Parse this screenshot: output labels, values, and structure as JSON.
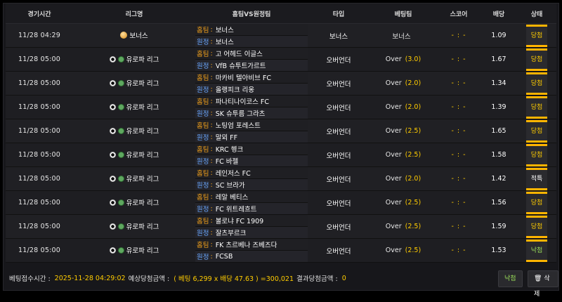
{
  "headers": {
    "time": "경기시간",
    "league": "리그명",
    "teams": "홈팀VS원정팀",
    "type": "타입",
    "betting_team": "베팅팀",
    "score": "스코어",
    "odds": "배당",
    "status": "상태"
  },
  "labels": {
    "home": "홈팀",
    "away": "원정",
    "over": "Over"
  },
  "rows": [
    {
      "time": "11/28 04:29",
      "league": "보너스",
      "league_icon": "coin-icon",
      "home": "보너스",
      "away": "보너스",
      "type": "보너스",
      "bet": "보너스",
      "line": "",
      "score": "- : -",
      "odds": "1.09",
      "status": "당첨"
    },
    {
      "time": "11/28 05:00",
      "league": "유로파 리그",
      "league_icon": "soccer-ball-icon",
      "home": "고 어헤드 이글스",
      "away": "VfB 슈투트가르트",
      "type": "오버언더",
      "bet": "Over",
      "line": "(3.0)",
      "score": "- : -",
      "odds": "1.67",
      "status": "당첨"
    },
    {
      "time": "11/28 05:00",
      "league": "유로파 리그",
      "league_icon": "soccer-ball-icon",
      "home": "마카비 텔아비브 FC",
      "away": "올랭피크 리옹",
      "type": "오버언더",
      "bet": "Over",
      "line": "(2.0)",
      "score": "- : -",
      "odds": "1.34",
      "status": "당첨"
    },
    {
      "time": "11/28 05:00",
      "league": "유로파 리그",
      "league_icon": "soccer-ball-icon",
      "home": "파나티나이코스 FC",
      "away": "SK 슈투름 그라츠",
      "type": "오버언더",
      "bet": "Over",
      "line": "(2.0)",
      "score": "- : -",
      "odds": "1.39",
      "status": "당첨"
    },
    {
      "time": "11/28 05:00",
      "league": "유로파 리그",
      "league_icon": "soccer-ball-icon",
      "home": "노팅엄 포레스트",
      "away": "말뫼 FF",
      "type": "오버언더",
      "bet": "Over",
      "line": "(2.5)",
      "score": "- : -",
      "odds": "1.65",
      "status": "당첨"
    },
    {
      "time": "11/28 05:00",
      "league": "유로파 리그",
      "league_icon": "soccer-ball-icon",
      "home": "KRC 헹크",
      "away": "FC 바젤",
      "type": "오버언더",
      "bet": "Over",
      "line": "(2.5)",
      "score": "- : -",
      "odds": "1.58",
      "status": "당첨"
    },
    {
      "time": "11/28 05:00",
      "league": "유로파 리그",
      "league_icon": "soccer-ball-icon",
      "home": "레인저스 FC",
      "away": "SC 브라가",
      "type": "오버언더",
      "bet": "Over",
      "line": "(2.0)",
      "score": "- : -",
      "odds": "1.42",
      "status": "적특"
    },
    {
      "time": "11/28 05:00",
      "league": "유로파 리그",
      "league_icon": "soccer-ball-icon",
      "home": "레알 베티스",
      "away": "FC 위트레흐트",
      "type": "오버언더",
      "bet": "Over",
      "line": "(2.5)",
      "score": "- : -",
      "odds": "1.56",
      "status": "당첨"
    },
    {
      "time": "11/28 05:00",
      "league": "유로파 리그",
      "league_icon": "soccer-ball-icon",
      "home": "볼로냐 FC 1909",
      "away": "잘츠부르크",
      "type": "오버언더",
      "bet": "Over",
      "line": "(2.5)",
      "score": "- : -",
      "odds": "1.59",
      "status": "당첨"
    },
    {
      "time": "11/28 05:00",
      "league": "유로파 리그",
      "league_icon": "soccer-ball-icon",
      "home": "FK 츠르베나 즈베즈다",
      "away": "FCSB",
      "type": "오버언더",
      "bet": "Over",
      "line": "(2.5)",
      "score": "- : -",
      "odds": "1.53",
      "status": "낙첨"
    }
  ],
  "footer": {
    "bet_time_label": "베팅접수시간 :",
    "bet_time": "2025-11-28 04:29:02",
    "expected_label": "예상당첨금액 :",
    "expected": "( 베팅 6,299 x 배당 47.63 ) =300,021",
    "result_label": "결과당첨금액 :",
    "result": "0"
  },
  "buttons": {
    "pending": "낙첨",
    "delete": "삭제"
  },
  "colors": {
    "accent": "#ffcc00",
    "status_border": "#ffb400",
    "home_tag": "#f3a21b"
  }
}
